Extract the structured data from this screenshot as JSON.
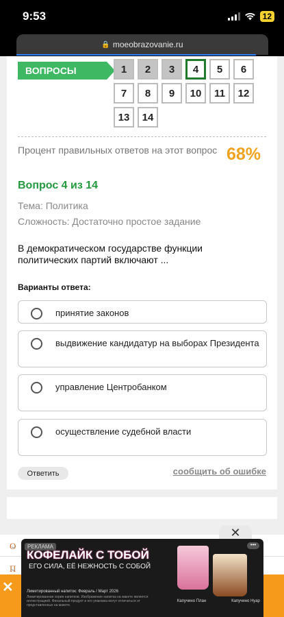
{
  "status": {
    "time": "9:53",
    "battery": "12"
  },
  "browser": {
    "url": "moeobrazovanie.ru"
  },
  "questions_nav": {
    "label": "ВОПРОСЫ",
    "items": [
      "1",
      "2",
      "3",
      "4",
      "5",
      "6",
      "7",
      "8",
      "9",
      "10",
      "11",
      "12",
      "13",
      "14"
    ],
    "current": "4",
    "done": [
      "1",
      "2",
      "3"
    ]
  },
  "stats": {
    "percent_text": "Процент правильных ответов на этот вопрос",
    "percent_value": "68%"
  },
  "question": {
    "title": "Вопрос 4 из 14",
    "topic": "Тема: Политика",
    "difficulty": "Сложность: Достаточно простое задание",
    "text": "В демократическом государстве функции политических партий включают ..."
  },
  "answers": {
    "label": "Варианты ответа:",
    "options": [
      "принятие законов",
      "выдвижение кандидатур на выборах Президента",
      "управление Центробанком",
      "осуществление судебной власти"
    ]
  },
  "actions": {
    "answer_button": "Ответить",
    "report_link": "сообщить об ошибке"
  },
  "ad": {
    "tag": "РЕКЛАМА",
    "headline": "КОФЕЛАЙК С ТОБОЙ",
    "subline": "ЕГО СИЛА, ЕЁ НЕЖНОСТЬ С СОБОЙ",
    "fine_print_1": "Лимитированный напиток: Февраль / Март 2026",
    "fine_print_2": "Лимитированная серия напитков. Изображение напитка на макете является иллюстрацией. Финальный продукт и его упаковка могут отличаться от представленных на макете.",
    "caption_left": "Капучино\nПлан",
    "caption_right": "Капучино\nНуар",
    "close_symbol": "✕",
    "side_letter": "О",
    "side_letter_2": "П"
  },
  "colors": {
    "accent_green": "#239a3f",
    "label_green": "#3fb864",
    "percent_orange": "#f0a320",
    "current_border": "#1f7a2c"
  }
}
